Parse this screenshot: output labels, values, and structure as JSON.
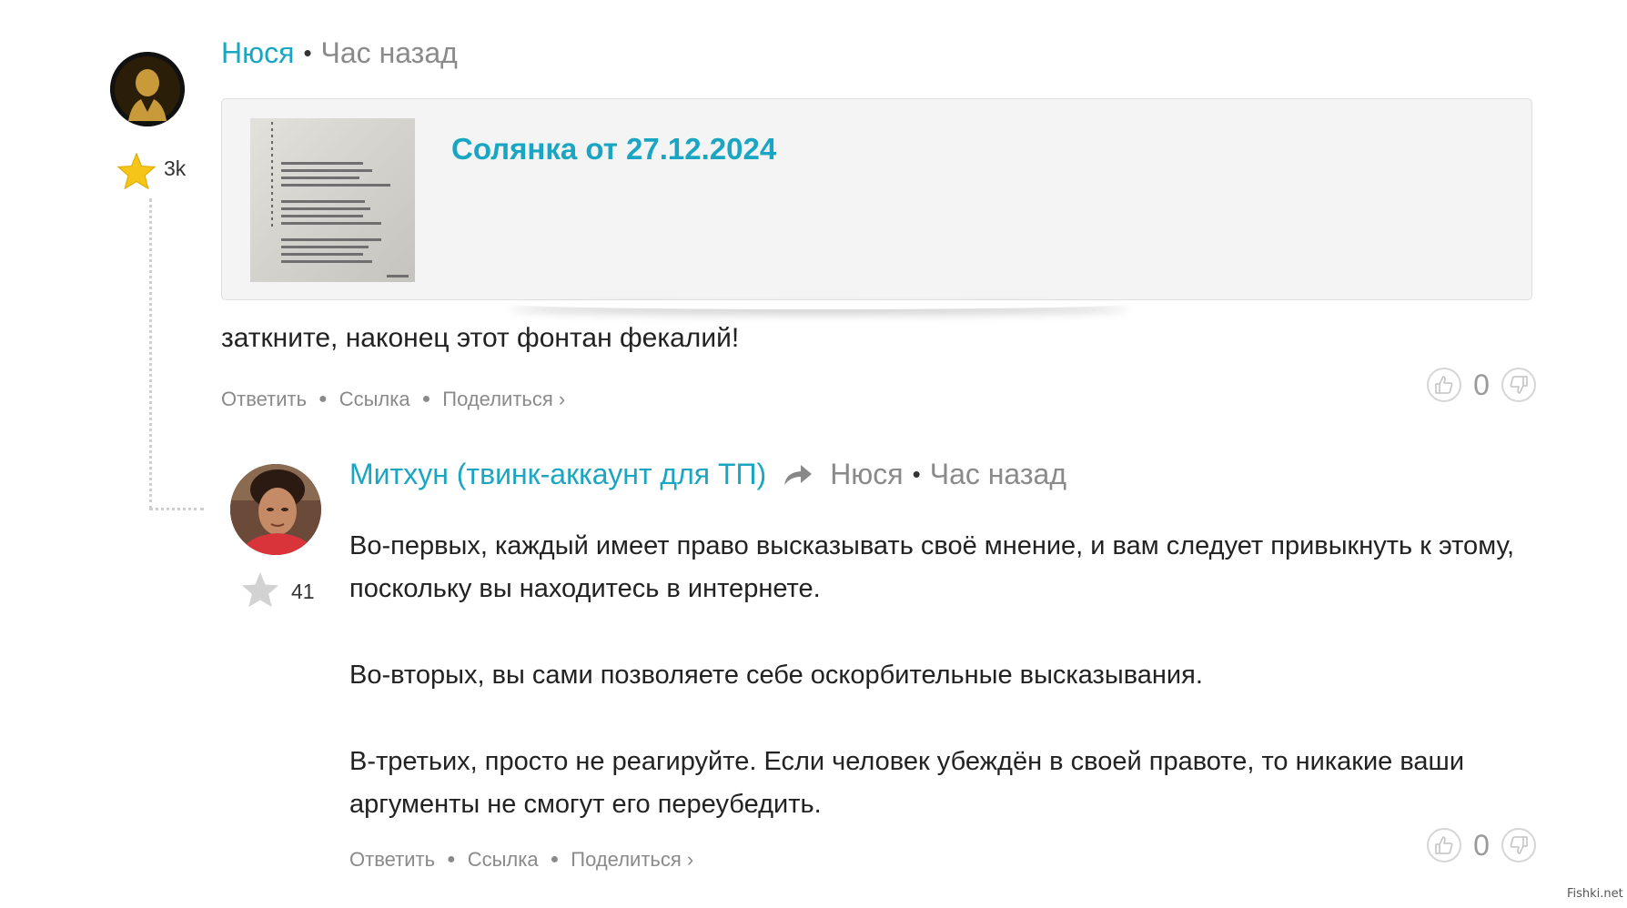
{
  "comment1": {
    "author": "Нюся",
    "time": "Час назад",
    "rating": "3k",
    "card_title": "Солянка от 27.12.2024",
    "text": "заткните, наконец этот фонтан фекалий!",
    "actions": {
      "reply": "Ответить",
      "link": "Ссылка",
      "share": "Поделиться ›"
    },
    "votes": "0"
  },
  "comment2": {
    "author": "Митхун (твинк-аккаунт для ТП)",
    "reply_to": "Нюся",
    "time": "Час назад",
    "rating": "41",
    "paragraphs": [
      "Во-первых, каждый имеет право высказывать своё мнение, и вам следует привыкнуть к этому, поскольку вы находитесь в интернете.",
      "Во-вторых, вы сами позволяете себе оскорбительные высказывания.",
      "В-третьих, просто не реагируйте. Если человек убеждён в своей правоте, то никакие ваши аргументы не смогут его переубедить."
    ],
    "actions": {
      "reply": "Ответить",
      "link": "Ссылка",
      "share": "Поделиться ›"
    },
    "votes": "0"
  },
  "watermark": "Fishki.net",
  "colors": {
    "accent": "#1aa6c2",
    "muted": "#8a8a8a",
    "star_gold": "#f5c518",
    "star_gray": "#d2d2d2"
  },
  "icons": [
    "user-avatar",
    "star-icon",
    "reply-arrow-icon",
    "thumb-up-icon",
    "thumb-down-icon",
    "image-thumbnail"
  ]
}
